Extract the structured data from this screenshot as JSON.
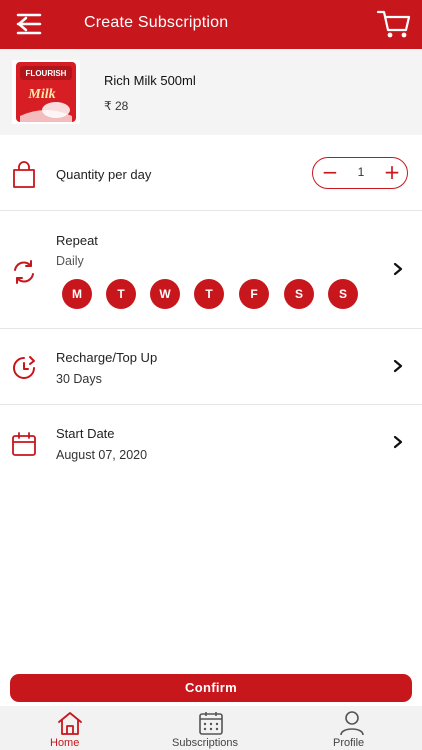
{
  "header": {
    "title": "Create Subscription"
  },
  "product": {
    "name": "Rich Milk 500ml",
    "price": "₹ 28",
    "thumb_brand": "FLOURISH",
    "thumb_text": "Milk"
  },
  "quantity": {
    "label": "Quantity per day",
    "value": "1",
    "minus": "−",
    "plus": "+"
  },
  "repeat": {
    "label": "Repeat",
    "frequency": "Daily",
    "days": [
      "M",
      "T",
      "W",
      "T",
      "F",
      "S",
      "S"
    ]
  },
  "recharge": {
    "label": "Recharge/Top Up",
    "value": "30 Days"
  },
  "start_date": {
    "label": "Start Date",
    "value": "August 07, 2020"
  },
  "confirm_label": "Confirm",
  "nav": {
    "home": "Home",
    "subscriptions": "Subscriptions",
    "profile": "Profile"
  },
  "colors": {
    "primary": "#c8161d",
    "header_text": "#ffffff",
    "product_bg": "#f4f4f4",
    "nav_bg": "#f2f2f2"
  },
  "icons": {
    "back": "back-arrow-icon",
    "cart": "cart-icon",
    "bag": "shopping-bag-icon",
    "repeat": "refresh-icon",
    "recharge": "clock-history-icon",
    "calendar": "calendar-icon",
    "chevron": "chevron-right-icon",
    "home": "home-icon",
    "subscriptions": "calendar-grid-icon",
    "profile": "user-icon"
  }
}
